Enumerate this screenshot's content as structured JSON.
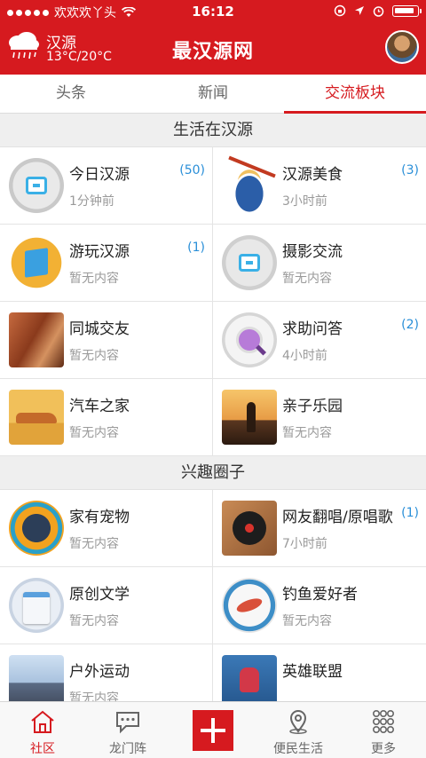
{
  "status_bar": {
    "carrier": "欢欢欢丫头",
    "time": "16:12"
  },
  "header": {
    "weather_city": "汉源",
    "weather_temp": "13°C/20°C",
    "title": "最汉源网"
  },
  "tabs": [
    {
      "label": "头条",
      "active": false
    },
    {
      "label": "新闻",
      "active": false
    },
    {
      "label": "交流板块",
      "active": true
    }
  ],
  "sections": [
    {
      "title": "生活在汉源",
      "items": [
        {
          "title": "今日汉源",
          "sub": "1分钟前",
          "count": "(50)",
          "icon": "camera-icon"
        },
        {
          "title": "汉源美食",
          "sub": "3小时前",
          "count": "(3)",
          "icon": "food-bowl-icon"
        },
        {
          "title": "游玩汉源",
          "sub": "暂无内容",
          "count": "(1)",
          "icon": "map-icon"
        },
        {
          "title": "摄影交流",
          "sub": "暂无内容",
          "count": "",
          "icon": "camera-icon"
        },
        {
          "title": "同城交友",
          "sub": "暂无内容",
          "count": "",
          "icon": "couple-photo"
        },
        {
          "title": "求助问答",
          "sub": "4小时前",
          "count": "(2)",
          "icon": "magnifier-icon"
        },
        {
          "title": "汽车之家",
          "sub": "暂无内容",
          "count": "",
          "icon": "car-photo"
        },
        {
          "title": "亲子乐园",
          "sub": "暂无内容",
          "count": "",
          "icon": "family-photo"
        }
      ]
    },
    {
      "title": "兴趣圈子",
      "items": [
        {
          "title": "家有宠物",
          "sub": "暂无内容",
          "count": "",
          "icon": "dog-food-badge-icon"
        },
        {
          "title": "网友翻唱/原唱歌",
          "sub": "7小时前",
          "count": "(1)",
          "icon": "record-player-icon"
        },
        {
          "title": "原创文学",
          "sub": "暂无内容",
          "count": "",
          "icon": "notes-icon"
        },
        {
          "title": "钓鱼爱好者",
          "sub": "暂无内容",
          "count": "",
          "icon": "fish-badge-icon"
        },
        {
          "title": "户外运动",
          "sub": "暂无内容",
          "count": "",
          "icon": "hiking-photo"
        },
        {
          "title": "英雄联盟",
          "sub": "",
          "count": "",
          "icon": "game-character-icon"
        }
      ]
    }
  ],
  "bottom_nav": [
    {
      "label": "社区",
      "icon": "home-icon",
      "active": true
    },
    {
      "label": "龙门阵",
      "icon": "chat-bubble-icon",
      "active": false
    },
    {
      "label": "",
      "icon": "add-icon",
      "active": false
    },
    {
      "label": "便民生活",
      "icon": "location-pin-icon",
      "active": false
    },
    {
      "label": "更多",
      "icon": "grid-dots-icon",
      "active": false
    }
  ],
  "colors": {
    "brand_red": "#d61a1f",
    "count_blue": "#2a8fd8",
    "section_bg": "#efefef"
  }
}
